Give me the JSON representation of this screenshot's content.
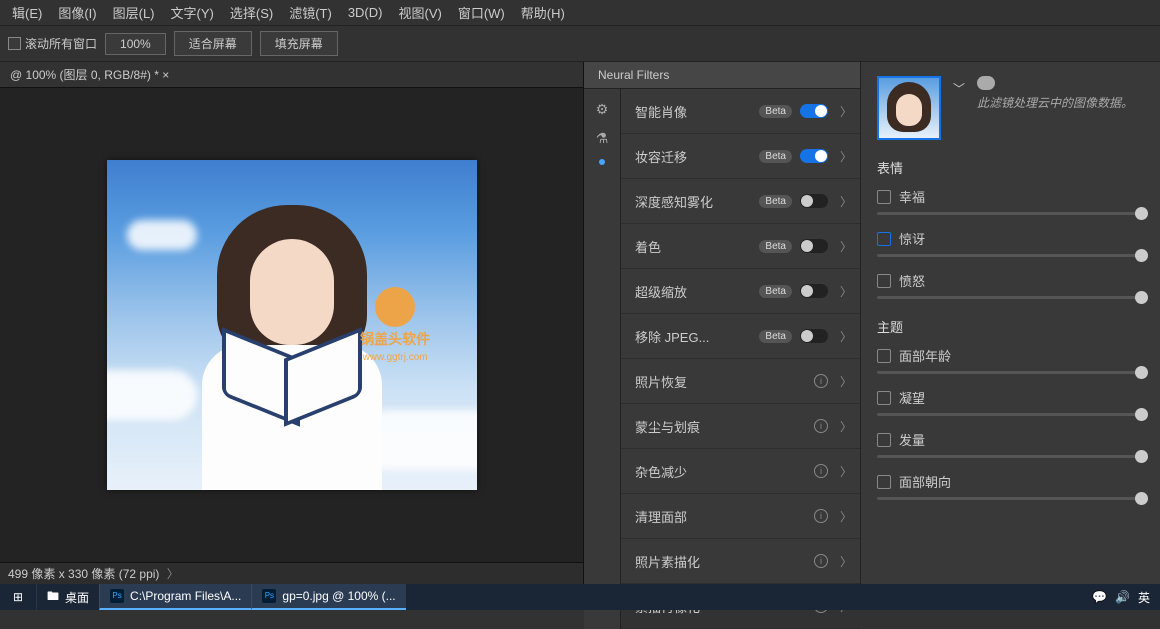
{
  "menu": [
    "辑(E)",
    "图像(I)",
    "图层(L)",
    "文字(Y)",
    "选择(S)",
    "滤镜(T)",
    "3D(D)",
    "视图(V)",
    "窗口(W)",
    "帮助(H)"
  ],
  "toolbar": {
    "scroll_all": "滚动所有窗口",
    "zoom": "100%",
    "fit_screen": "适合屏幕",
    "fill_screen": "填充屏幕"
  },
  "doc_tab": "@ 100% (图层 0, RGB/8#) * ×",
  "status_bar": "499 像素 x 330 像素 (72 ppi)",
  "watermark": {
    "title": "锅盖头软件",
    "sub": "www.ggtrj.com"
  },
  "panel_title": "Neural Filters",
  "filters": [
    {
      "name": "智能肖像",
      "badge": "Beta",
      "toggle": true,
      "on": true,
      "chev": true
    },
    {
      "name": "妆容迁移",
      "badge": "Beta",
      "toggle": true,
      "on": true,
      "chev": true
    },
    {
      "name": "深度感知雾化",
      "badge": "Beta",
      "toggle": true,
      "on": false,
      "chev": true
    },
    {
      "name": "着色",
      "badge": "Beta",
      "toggle": true,
      "on": false,
      "chev": true
    },
    {
      "name": "超级缩放",
      "badge": "Beta",
      "toggle": true,
      "on": false,
      "chev": true
    },
    {
      "name": "移除 JPEG...",
      "badge": "Beta",
      "toggle": true,
      "on": false,
      "chev": true
    },
    {
      "name": "照片恢复",
      "info": true,
      "chev": true
    },
    {
      "name": "蒙尘与划痕",
      "info": true,
      "chev": true
    },
    {
      "name": "杂色减少",
      "info": true,
      "chev": true
    },
    {
      "name": "清理面部",
      "info": true,
      "chev": true
    },
    {
      "name": "照片素描化",
      "info": true,
      "chev": true
    },
    {
      "name": "素描肖像化",
      "info": true,
      "chev": true
    }
  ],
  "right": {
    "note": "此滤镜处理云中的图像数据。",
    "section_expression": "表情",
    "section_theme": "主题",
    "sliders_expression": [
      {
        "label": "幸福",
        "checked": false
      },
      {
        "label": "惊讶",
        "checked": true
      },
      {
        "label": "愤怒",
        "checked": false
      }
    ],
    "sliders_theme": [
      {
        "label": "面部年龄",
        "checked": false
      },
      {
        "label": "凝望",
        "checked": false
      },
      {
        "label": "发量",
        "checked": false
      },
      {
        "label": "面部朝向",
        "checked": false
      }
    ]
  },
  "taskbar": {
    "desktop": "桌面",
    "item1": "C:\\Program Files\\A...",
    "item2": "gp=0.jpg @ 100% (...",
    "ime": "英"
  }
}
